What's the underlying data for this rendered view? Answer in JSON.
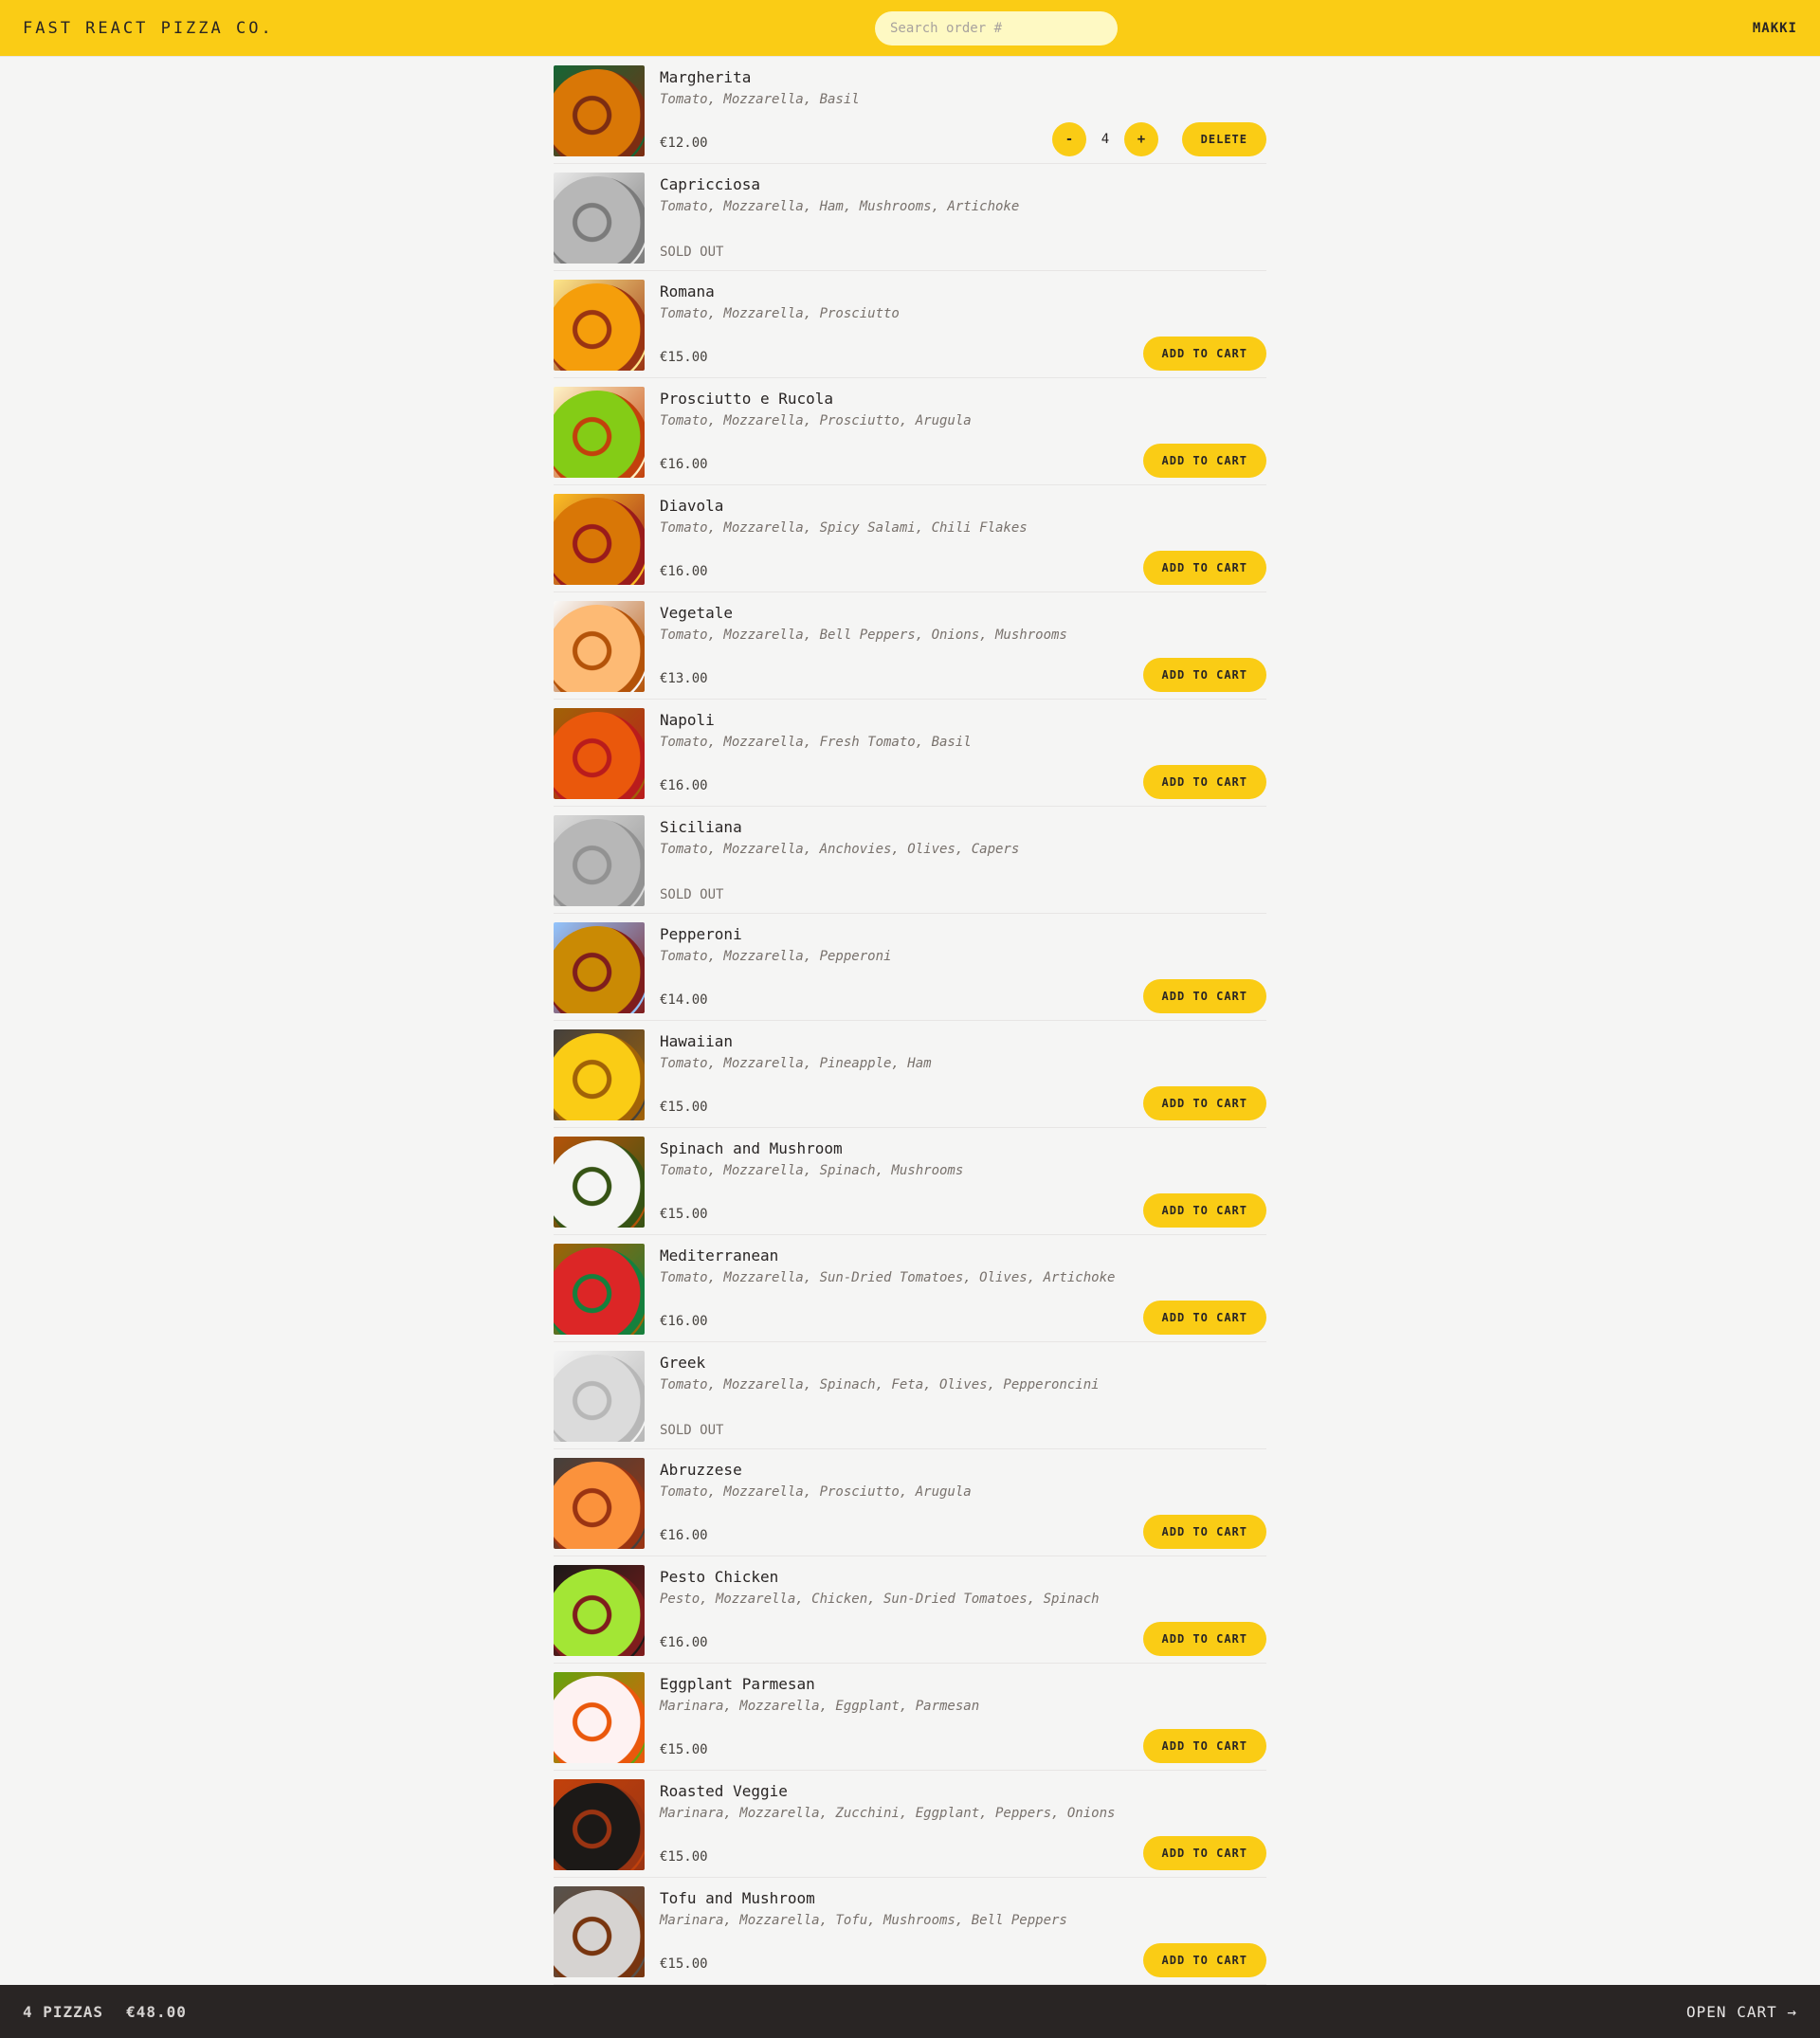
{
  "header": {
    "logo": "Fast React Pizza Co.",
    "search_placeholder": "Search order #",
    "user": "makki"
  },
  "menu": [
    {
      "name": "Margherita",
      "ingredients": "Tomato, Mozzarella, Basil",
      "price": "€12.00",
      "sold_out": false,
      "in_cart": true,
      "quantity": "4",
      "colors": [
        "#7c2d12",
        "#d97706",
        "#166534"
      ]
    },
    {
      "name": "Capricciosa",
      "ingredients": "Tomato, Mozzarella, Ham, Mushrooms, Artichoke",
      "price": "",
      "sold_out": true,
      "sold_out_label": "Sold out",
      "colors": [
        "#57534e",
        "#a8a29e",
        "#e7e5e4"
      ]
    },
    {
      "name": "Romana",
      "ingredients": "Tomato, Mozzarella, Prosciutto",
      "price": "€15.00",
      "sold_out": false,
      "colors": [
        "#9a3412",
        "#f59e0b",
        "#fde68a"
      ]
    },
    {
      "name": "Prosciutto e Rucola",
      "ingredients": "Tomato, Mozzarella, Prosciutto, Arugula",
      "price": "€16.00",
      "sold_out": false,
      "colors": [
        "#c2410c",
        "#84cc16",
        "#fef3c7"
      ]
    },
    {
      "name": "Diavola",
      "ingredients": "Tomato, Mozzarella, Spicy Salami, Chili Flakes",
      "price": "€16.00",
      "sold_out": false,
      "colors": [
        "#991b1b",
        "#d97706",
        "#fbbf24"
      ]
    },
    {
      "name": "Vegetale",
      "ingredients": "Tomato, Mozzarella, Bell Peppers, Onions, Mushrooms",
      "price": "€13.00",
      "sold_out": false,
      "colors": [
        "#b45309",
        "#fdba74",
        "#fafaf9"
      ]
    },
    {
      "name": "Napoli",
      "ingredients": "Tomato, Mozzarella, Fresh Tomato, Basil",
      "price": "€16.00",
      "sold_out": false,
      "colors": [
        "#b91c1c",
        "#ea580c",
        "#a16207"
      ]
    },
    {
      "name": "Siciliana",
      "ingredients": "Tomato, Mozzarella, Anchovies, Olives, Capers",
      "price": "",
      "sold_out": true,
      "sold_out_label": "Sold out",
      "colors": [
        "#78716c",
        "#a8a29e",
        "#d6d3d1"
      ]
    },
    {
      "name": "Pepperoni",
      "ingredients": "Tomato, Mozzarella, Pepperoni",
      "price": "€14.00",
      "sold_out": false,
      "colors": [
        "#7f1d1d",
        "#ca8a04",
        "#93c5fd"
      ]
    },
    {
      "name": "Hawaiian",
      "ingredients": "Tomato, Mozzarella, Pineapple, Ham",
      "price": "€15.00",
      "sold_out": false,
      "colors": [
        "#a16207",
        "#facc15",
        "#44403c"
      ]
    },
    {
      "name": "Spinach and Mushroom",
      "ingredients": "Tomato, Mozzarella, Spinach, Mushrooms",
      "price": "€15.00",
      "sold_out": false,
      "colors": [
        "#365314",
        "#f5f5f4",
        "#b45309"
      ]
    },
    {
      "name": "Mediterranean",
      "ingredients": "Tomato, Mozzarella, Sun-Dried Tomatoes, Olives, Artichoke",
      "price": "€16.00",
      "sold_out": false,
      "colors": [
        "#15803d",
        "#dc2626",
        "#a16207"
      ]
    },
    {
      "name": "Greek",
      "ingredients": "Tomato, Mozzarella, Spinach, Feta, Olives, Pepperoncini",
      "price": "",
      "sold_out": true,
      "sold_out_label": "Sold out",
      "colors": [
        "#a8a29e",
        "#d6d3d1",
        "#f5f5f4"
      ]
    },
    {
      "name": "Abruzzese",
      "ingredients": "Tomato, Mozzarella, Prosciutto, Arugula",
      "price": "€16.00",
      "sold_out": false,
      "colors": [
        "#9a3412",
        "#fb923c",
        "#44403c"
      ]
    },
    {
      "name": "Pesto Chicken",
      "ingredients": "Pesto, Mozzarella, Chicken, Sun-Dried Tomatoes, Spinach",
      "price": "€16.00",
      "sold_out": false,
      "colors": [
        "#7f1d1d",
        "#a3e635",
        "#1c1917"
      ]
    },
    {
      "name": "Eggplant Parmesan",
      "ingredients": "Marinara, Mozzarella, Eggplant, Parmesan",
      "price": "€15.00",
      "sold_out": false,
      "colors": [
        "#ea580c",
        "#fef2f2",
        "#65a30d"
      ]
    },
    {
      "name": "Roasted Veggie",
      "ingredients": "Marinara, Mozzarella, Zucchini, Eggplant, Peppers, Onions",
      "price": "€15.00",
      "sold_out": false,
      "colors": [
        "#9a3412",
        "#1c1917",
        "#c2410c"
      ]
    },
    {
      "name": "Tofu and Mushroom",
      "ingredients": "Marinara, Mozzarella, Tofu, Mushrooms, Bell Peppers",
      "price": "€15.00",
      "sold_out": false,
      "colors": [
        "#78350f",
        "#d6d3d1",
        "#57534e"
      ]
    }
  ],
  "buttons": {
    "add_to_cart": "Add to cart",
    "delete": "Delete",
    "decrease": "-",
    "increase": "+"
  },
  "cart": {
    "count": "4 pizzas",
    "total": "€48.00",
    "open_label": "Open cart →"
  }
}
